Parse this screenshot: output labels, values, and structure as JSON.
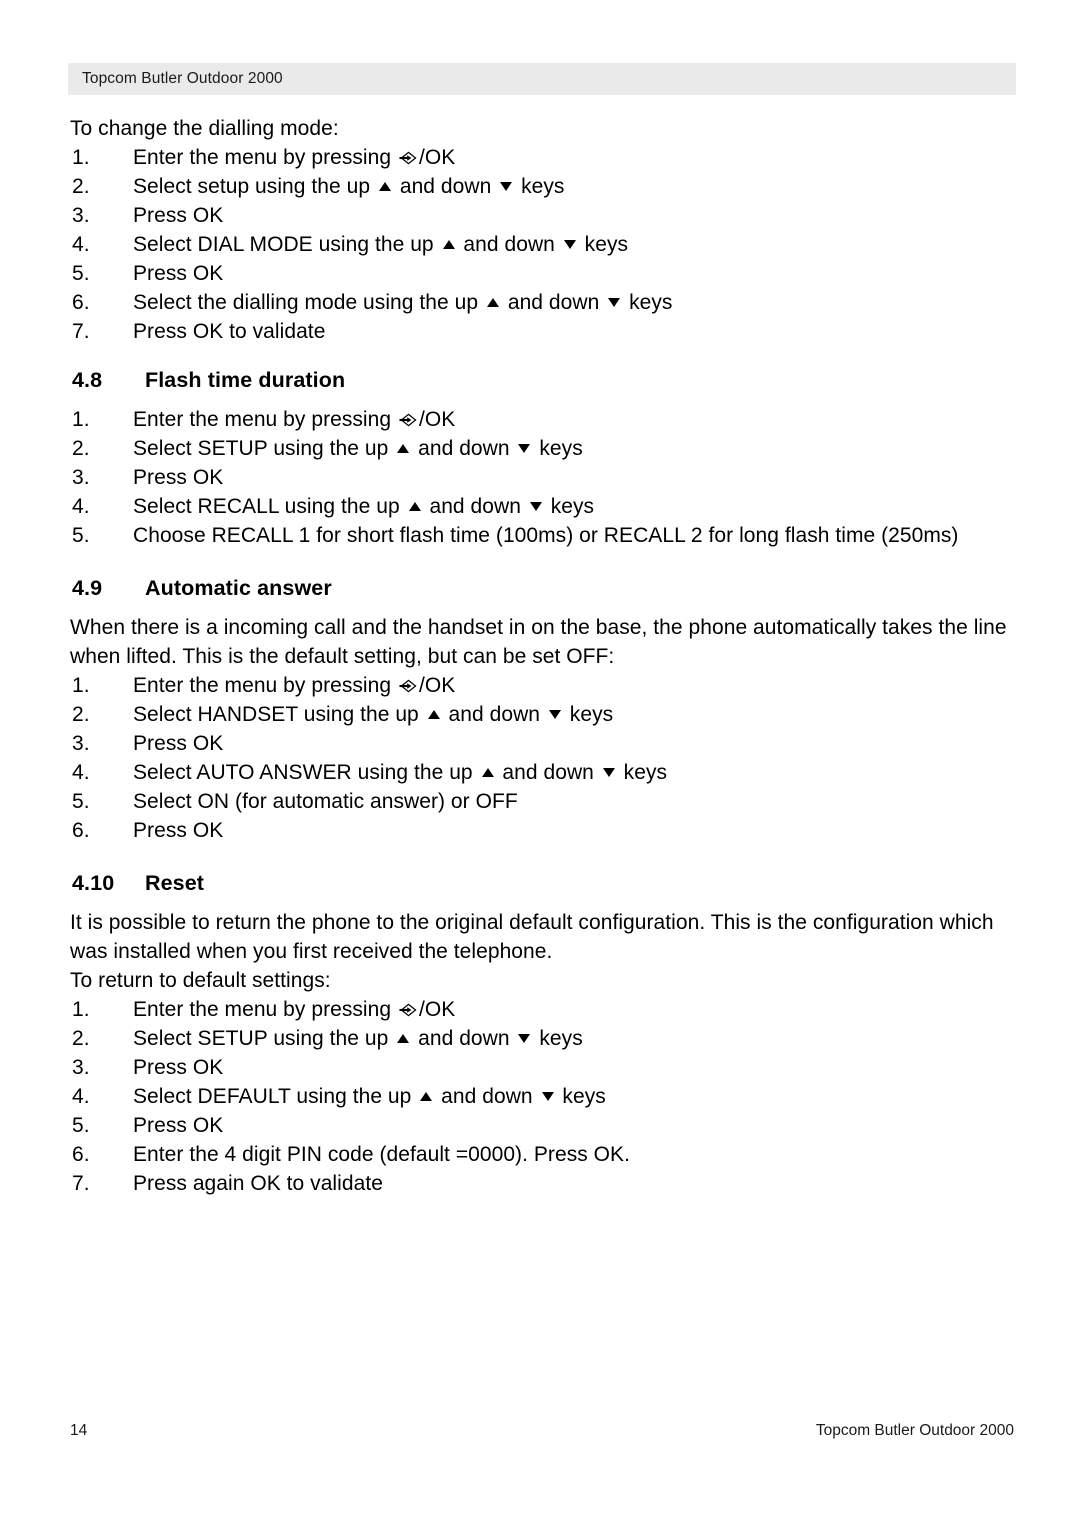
{
  "header": {
    "title": "Topcom Butler Outdoor 2000"
  },
  "footer": {
    "page_number": "14",
    "title": "Topcom Butler Outdoor 2000"
  },
  "icons": {
    "menu_ok": "menu-arrow-icon",
    "up_key": "up-triangle-icon",
    "down_key": "down-triangle-icon"
  },
  "intro": {
    "lead": "To change the dialling mode:",
    "steps": [
      {
        "num": "1.",
        "pre": "Enter the menu by pressing ",
        "icon": "menu",
        "post": "/OK"
      },
      {
        "num": "2.",
        "pre": "Select setup using the up ",
        "icon": "up",
        "mid": " and down ",
        "icon2": "down",
        "post": " keys"
      },
      {
        "num": "3.",
        "pre": "Press OK"
      },
      {
        "num": "4.",
        "pre": "Select DIAL MODE using the up ",
        "icon": "up",
        "mid": " and down ",
        "icon2": "down",
        "post": " keys"
      },
      {
        "num": "5.",
        "pre": "Press OK"
      },
      {
        "num": "6.",
        "pre": "Select the dialling mode using the up ",
        "icon": "up",
        "mid": " and down ",
        "icon2": "down",
        "post": " keys"
      },
      {
        "num": "7.",
        "pre": "Press OK to validate"
      }
    ]
  },
  "sections": [
    {
      "number": "4.8",
      "title": "Flash time duration",
      "paragraphs": [],
      "steps": [
        {
          "num": "1.",
          "pre": "Enter the menu by pressing ",
          "icon": "menu",
          "post": "/OK"
        },
        {
          "num": "2.",
          "pre": "Select SETUP using the up ",
          "icon": "up",
          "mid": " and down ",
          "icon2": "down",
          "post": " keys"
        },
        {
          "num": "3.",
          "pre": "Press OK"
        },
        {
          "num": "4.",
          "pre": "Select RECALL using the up ",
          "icon": "up",
          "mid": " and down ",
          "icon2": "down",
          "post": " keys"
        },
        {
          "num": "5.",
          "pre": "Choose RECALL 1 for short flash time (100ms) or RECALL 2 for long flash time (250ms)"
        }
      ]
    },
    {
      "number": "4.9",
      "title": "Automatic answer",
      "paragraphs": [
        "When there is a incoming call and the handset in on the base, the phone automatically takes the line when lifted. This is the default setting, but can be set OFF:"
      ],
      "steps": [
        {
          "num": "1.",
          "pre": "Enter the menu by pressing ",
          "icon": "menu",
          "post": "/OK"
        },
        {
          "num": "2.",
          "pre": "Select HANDSET using the up ",
          "icon": "up",
          "mid": " and down ",
          "icon2": "down",
          "post": " keys"
        },
        {
          "num": "3.",
          "pre": "Press OK"
        },
        {
          "num": "4.",
          "pre": "Select AUTO ANSWER using the up ",
          "icon": "up",
          "mid": " and down ",
          "icon2": "down",
          "post": " keys"
        },
        {
          "num": "5.",
          "pre": "Select ON (for automatic answer) or OFF"
        },
        {
          "num": "6.",
          "pre": "Press OK"
        }
      ]
    },
    {
      "number": "4.10",
      "title": "Reset",
      "paragraphs": [
        "It is possible to return the phone to the original default configuration. This is the configuration which was installed when you first received the telephone.",
        "To return to default settings:"
      ],
      "steps": [
        {
          "num": "1.",
          "pre": "Enter the menu by pressing ",
          "icon": "menu",
          "post": "/OK"
        },
        {
          "num": "2.",
          "pre": "Select SETUP using the up ",
          "icon": "up",
          "mid": " and down ",
          "icon2": "down",
          "post": " keys"
        },
        {
          "num": "3.",
          "pre": "Press OK"
        },
        {
          "num": "4.",
          "pre": "Select DEFAULT using the up ",
          "icon": "up",
          "mid": " and down ",
          "icon2": "down",
          "post": " keys"
        },
        {
          "num": "5.",
          "pre": "Press OK"
        },
        {
          "num": "6.",
          "pre": "Enter the 4 digit PIN code (default =0000). Press OK."
        },
        {
          "num": "7.",
          "pre": "Press again OK to validate"
        }
      ]
    }
  ]
}
